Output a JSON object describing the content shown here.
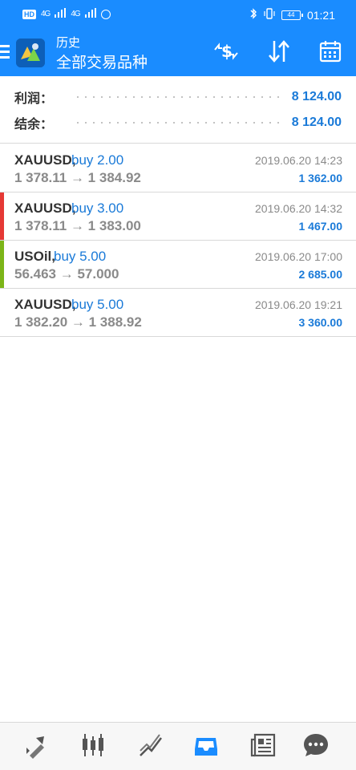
{
  "status_bar": {
    "hd_label": "HD",
    "signal1": "4G",
    "signal2": "4G",
    "battery": "44",
    "time": "01:21"
  },
  "toolbar": {
    "subtitle": "历史",
    "title": "全部交易品种"
  },
  "summary": {
    "profit_label": "利润：",
    "profit_value": "8 124.00",
    "balance_label": "结余：",
    "balance_value": "8 124.00"
  },
  "trades": [
    {
      "symbol": "XAUUSD,",
      "action": "buy 2.00",
      "prices": "1 378.11 → 1 384.92",
      "date": "2019.06.20 14:23",
      "profit": "1 362.00",
      "accent": "none"
    },
    {
      "symbol": "XAUUSD,",
      "action": "buy 3.00",
      "prices": "1 378.11 → 1 383.00",
      "date": "2019.06.20 14:32",
      "profit": "1 467.00",
      "accent": "#e53935"
    },
    {
      "symbol": "USOil,",
      "action": "buy 5.00",
      "prices": "56.463 → 57.000",
      "date": "2019.06.20 17:00",
      "profit": "2 685.00",
      "accent": "#7cb518"
    },
    {
      "symbol": "XAUUSD,",
      "action": "buy 5.00",
      "prices": "1 382.20 → 1 388.92",
      "date": "2019.06.20 19:21",
      "profit": "3 360.00",
      "accent": "none"
    }
  ],
  "colors": {
    "brand": "#1a8cff",
    "value_blue": "#1a7ad8",
    "accent_red": "#e53935",
    "accent_green": "#7cb518"
  },
  "bottom_nav": {
    "icons": [
      "trade-arrows-icon",
      "candles-icon",
      "chart-line-icon",
      "inbox-icon",
      "news-icon",
      "chat-icon"
    ],
    "active": "inbox-icon"
  }
}
